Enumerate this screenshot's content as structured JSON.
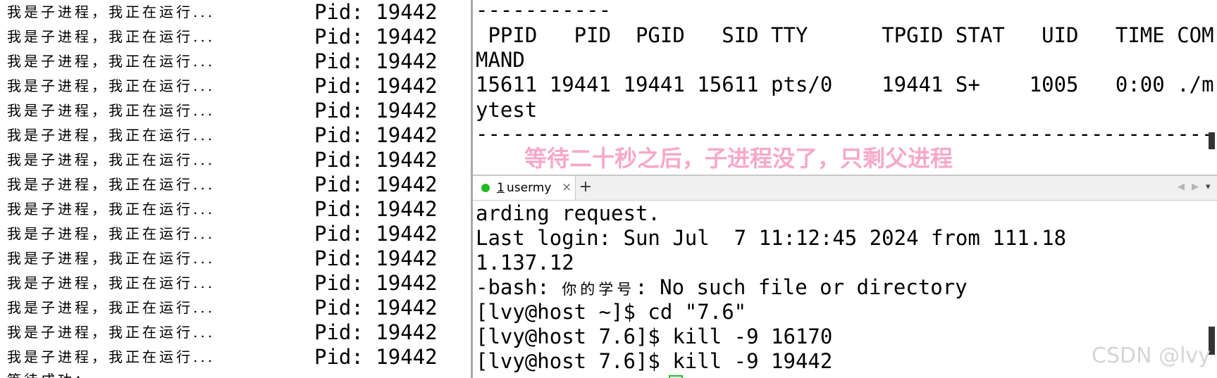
{
  "left_terminal": {
    "line_text": "我是子进程，我正在运行...",
    "pid_text": "Pid: 19442",
    "line_count": 15,
    "partial_line": "等待成功："
  },
  "top_terminal": {
    "lines": [
      "-----------",
      " PPID   PID  PGID   SID TTY      TPGID STAT   UID   TIME COM",
      "MAND",
      "15611 19441 19441 15611 pts/0    19441 S+    1005   0:00 ./m",
      "ytest",
      "-------------------------------------------------------------"
    ],
    "annotation": "等待二十秒之后，子进程没了，只剩父进程",
    "annotation_color": "#f7a8c8"
  },
  "tabbar": {
    "tab_number": "1",
    "tab_label": "usermy",
    "close_label": "×",
    "add_label": "+",
    "nav_left": "◀",
    "nav_right": "▶",
    "menu": "▾",
    "status_color": "#22bb22"
  },
  "bottom_terminal": {
    "line1": "arding request.",
    "line2": "Last login: Sun Jul  7 11:12:45 2024 from 111.18",
    "line3": "1.137.12",
    "line4_prefix": "-bash: ",
    "line4_cn": "你的学号",
    "line4_colon": ": ",
    "line4_suffix": "No such file or directory",
    "line5": "[lvy@host ~]$ cd \"7.6\"",
    "line6": "[lvy@host 7.6]$ kill -9 16170",
    "line7": "[lvy@host 7.6]$ kill -9 19442"
  },
  "watermark": "CSDN @lvy"
}
